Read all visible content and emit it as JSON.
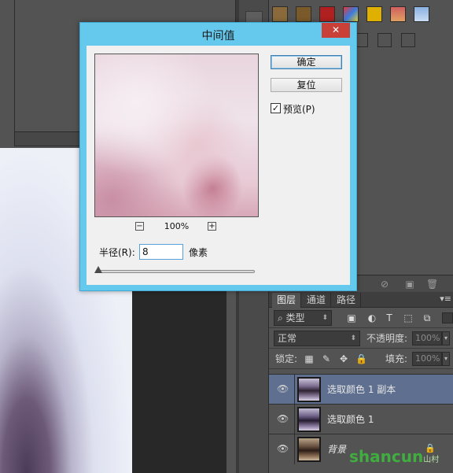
{
  "dialog": {
    "title": "中间值",
    "close_glyph": "✕",
    "ok_label": "确定",
    "reset_label": "复位",
    "preview_checkbox": {
      "checked": true,
      "label": "预览(P)"
    },
    "zoom": {
      "minus": "−",
      "plus": "+",
      "level": "100%"
    },
    "radius": {
      "label": "半径(R):",
      "value": "8",
      "unit": "像素"
    }
  },
  "layers_panel": {
    "tabs": [
      "图层",
      "通道",
      "路径"
    ],
    "tab_menu_glyph": "▾≡",
    "filter_kind": "类型",
    "blend_mode": "正常",
    "opacity_label": "不透明度:",
    "opacity_value": "100%",
    "lock_label": "锁定:",
    "fill_label": "填充:",
    "fill_value": "100%",
    "layers": [
      {
        "name": "选取颜色 1 副本",
        "selected": true
      },
      {
        "name": "选取颜色 1",
        "selected": false
      },
      {
        "name": "背景",
        "selected": false,
        "locked": true
      }
    ]
  },
  "watermark": {
    "text": "shancun",
    "suffix": "山村 .net"
  },
  "colors": {
    "dialog_frame": "#65c9ee",
    "close_button": "#c94038",
    "selected_layer": "#5e6f8f"
  }
}
